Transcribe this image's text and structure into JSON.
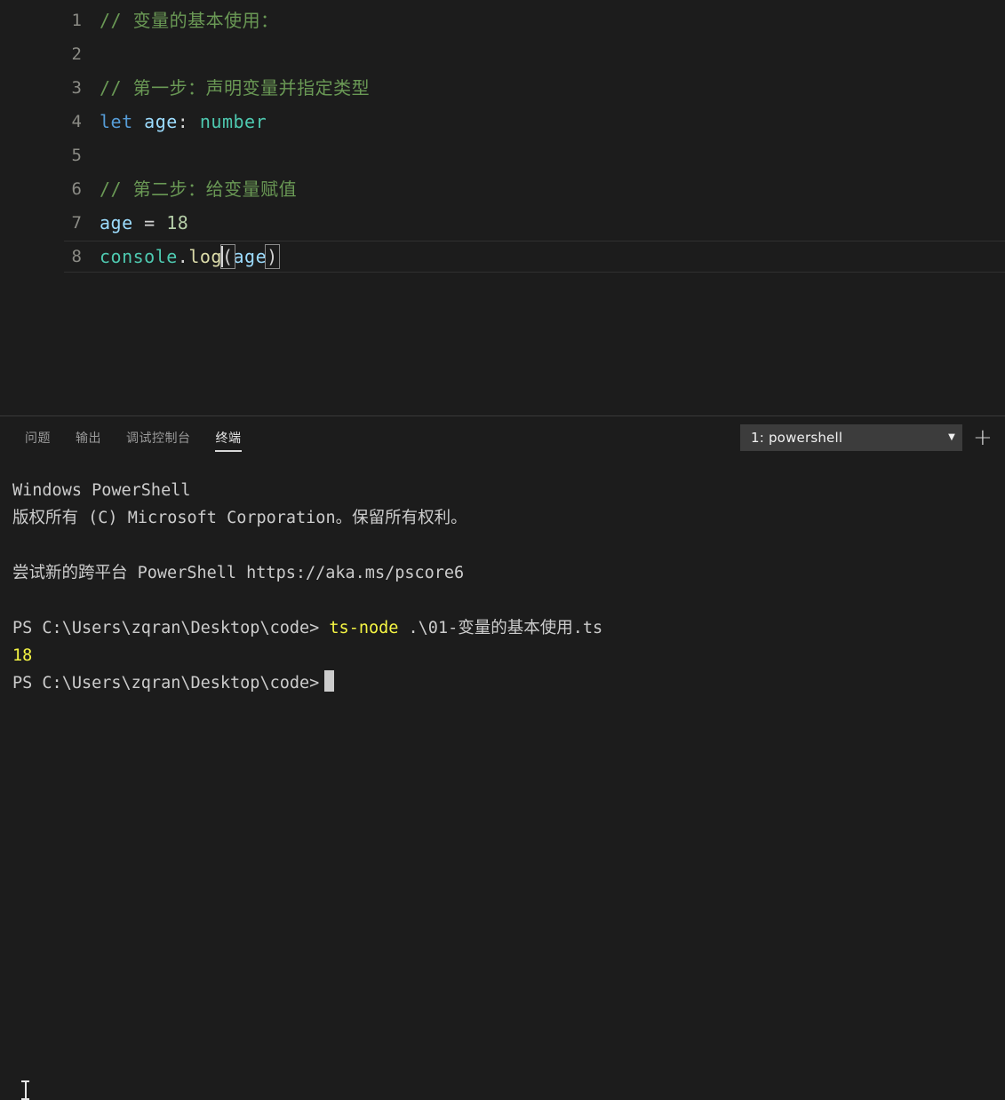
{
  "editor": {
    "lines": [
      {
        "number": "1",
        "tokens": [
          {
            "text": "// 变量的基本使用：",
            "kind": "comment"
          }
        ]
      },
      {
        "number": "2",
        "tokens": []
      },
      {
        "number": "3",
        "tokens": [
          {
            "text": "// 第一步：声明变量并指定类型",
            "kind": "comment"
          }
        ]
      },
      {
        "number": "4",
        "tokens": [
          {
            "text": "let",
            "kind": "keyword"
          },
          {
            "text": " ",
            "kind": "punct"
          },
          {
            "text": "age",
            "kind": "var"
          },
          {
            "text": ":",
            "kind": "punct"
          },
          {
            "text": " ",
            "kind": "punct"
          },
          {
            "text": "number",
            "kind": "type"
          }
        ]
      },
      {
        "number": "5",
        "tokens": []
      },
      {
        "number": "6",
        "tokens": [
          {
            "text": "// 第二步：给变量赋值",
            "kind": "comment"
          }
        ]
      },
      {
        "number": "7",
        "tokens": [
          {
            "text": "age",
            "kind": "var"
          },
          {
            "text": " = ",
            "kind": "punct"
          },
          {
            "text": "18",
            "kind": "num"
          }
        ]
      },
      {
        "number": "8",
        "current": true,
        "tokens": [
          {
            "text": "console",
            "kind": "obj"
          },
          {
            "text": ".",
            "kind": "punct"
          },
          {
            "text": "log",
            "kind": "fn"
          },
          {
            "text": "(",
            "kind": "bracket-match"
          },
          {
            "text": "age",
            "kind": "var"
          },
          {
            "text": ")",
            "kind": "bracket-match"
          }
        ]
      }
    ]
  },
  "panel": {
    "tabs": [
      {
        "label": "问题",
        "active": false
      },
      {
        "label": "输出",
        "active": false
      },
      {
        "label": "调试控制台",
        "active": false
      },
      {
        "label": "终端",
        "active": true
      }
    ],
    "terminal_selector": {
      "value": "1: powershell",
      "chevron": "chevron-down-icon"
    },
    "new_terminal_label": "+"
  },
  "terminal": {
    "lines": [
      {
        "segments": [
          {
            "text": "Windows PowerShell",
            "color": "white"
          }
        ]
      },
      {
        "segments": [
          {
            "text": "版权所有 (C) Microsoft Corporation。保留所有权利。",
            "color": "white"
          }
        ]
      },
      {
        "segments": []
      },
      {
        "segments": [
          {
            "text": "尝试新的跨平台 PowerShell https://aka.ms/pscore6",
            "color": "white"
          }
        ]
      },
      {
        "segments": []
      },
      {
        "segments": [
          {
            "text": "PS C:\\Users\\zqran\\Desktop\\code> ",
            "color": "white"
          },
          {
            "text": "ts-node",
            "color": "yellow"
          },
          {
            "text": " .\\01-变量的基本使用.ts",
            "color": "white"
          }
        ]
      },
      {
        "segments": [
          {
            "text": "18",
            "color": "yellow"
          }
        ]
      },
      {
        "segments": [
          {
            "text": "PS C:\\Users\\zqran\\Desktop\\code>",
            "color": "white"
          }
        ],
        "cursor": true
      }
    ]
  },
  "colors": {
    "background": "#1c1c1c",
    "comment": "#6a9955",
    "keyword": "#569cd6",
    "variable": "#9cdcfe",
    "type": "#4ec9b0",
    "function": "#dcdcaa",
    "number": "#b5cea8",
    "terminal_yellow": "#f5f543",
    "terminal_text": "#cccccc",
    "select_background": "#3c3c3c"
  }
}
